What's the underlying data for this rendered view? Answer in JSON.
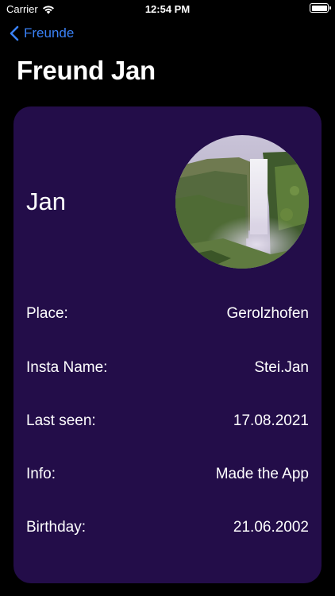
{
  "status": {
    "carrier": "Carrier",
    "time": "12:54 PM"
  },
  "nav": {
    "back_label": "Freunde",
    "title": "Freund Jan"
  },
  "friend": {
    "name": "Jan",
    "rows": [
      {
        "label": "Place:",
        "value": "Gerolzhofen"
      },
      {
        "label": "Insta Name:",
        "value": "Stei.Jan"
      },
      {
        "label": "Last seen:",
        "value": "17.08.2021"
      },
      {
        "label": "Info:",
        "value": "Made the App"
      },
      {
        "label": "Birthday:",
        "value": "21.06.2002"
      }
    ]
  },
  "colors": {
    "accent": "#3a82f7",
    "card_background": "#230d49",
    "background": "#000000"
  },
  "icons": {
    "back": "chevron-left-icon",
    "wifi": "wifi-icon",
    "battery": "battery-icon"
  }
}
